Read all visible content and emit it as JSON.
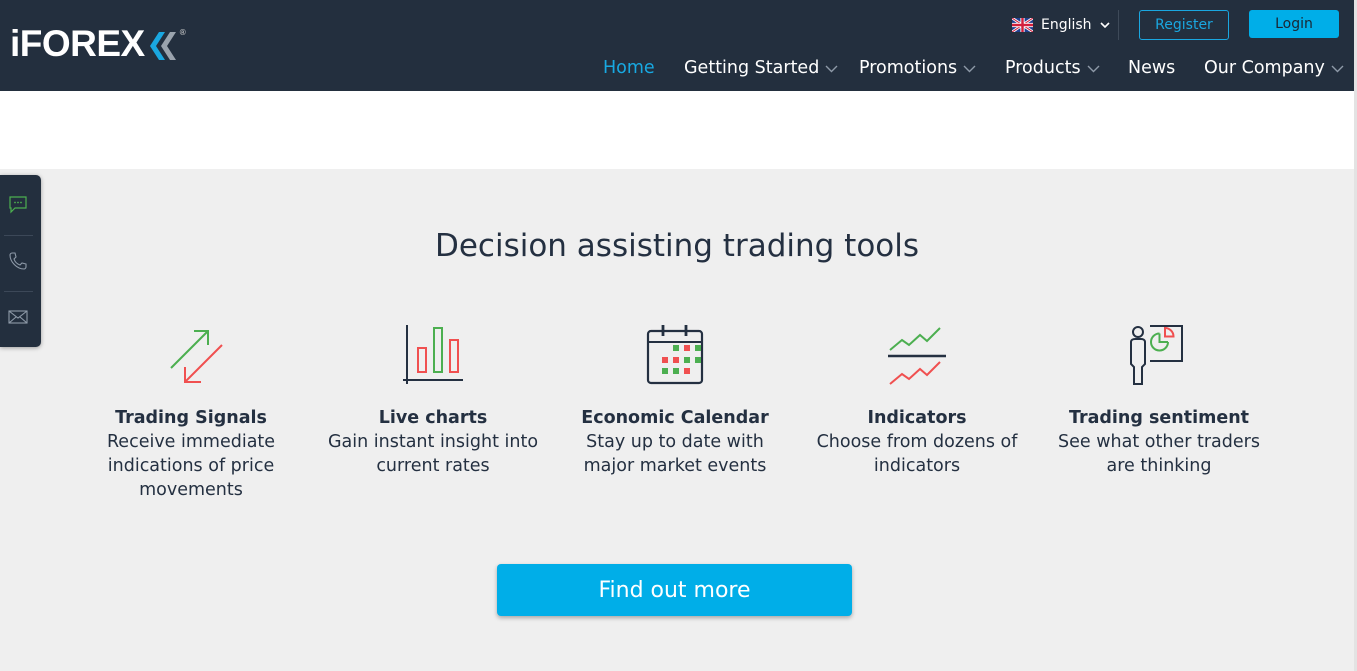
{
  "header": {
    "logo": {
      "text": "iFOREX",
      "registered_mark": "®"
    },
    "language": {
      "flag_icon": "uk-flag-icon",
      "label": "English"
    },
    "register_label": "Register",
    "login_label": "Login",
    "nav": [
      {
        "label": "Home",
        "active": true,
        "has_dropdown": false
      },
      {
        "label": "Getting Started",
        "active": false,
        "has_dropdown": true
      },
      {
        "label": "Promotions",
        "active": false,
        "has_dropdown": true
      },
      {
        "label": "Products",
        "active": false,
        "has_dropdown": true
      },
      {
        "label": "News",
        "active": false,
        "has_dropdown": false
      },
      {
        "label": "Our Company",
        "active": false,
        "has_dropdown": true
      }
    ]
  },
  "side_contact": [
    {
      "icon": "chat-icon"
    },
    {
      "icon": "phone-icon"
    },
    {
      "icon": "mail-icon"
    }
  ],
  "main": {
    "title": "Decision assisting trading tools",
    "tools": [
      {
        "icon": "trading-signals-icon",
        "title": "Trading Signals",
        "desc_lines": [
          "Receive immediate",
          "indications of price",
          "movements"
        ]
      },
      {
        "icon": "live-charts-icon",
        "title": "Live charts",
        "desc_lines": [
          "Gain instant insight into",
          "current rates"
        ]
      },
      {
        "icon": "economic-calendar-icon",
        "title": "Economic Calendar",
        "desc_lines": [
          "Stay up to date with",
          "major market events"
        ]
      },
      {
        "icon": "indicators-icon",
        "title": "Indicators",
        "desc_lines": [
          "Choose from dozens of",
          "indicators"
        ]
      },
      {
        "icon": "trading-sentiment-icon",
        "title": "Trading sentiment",
        "desc_lines": [
          "See what other traders",
          "are thinking"
        ]
      }
    ],
    "cta_label": "Find out more"
  },
  "colors": {
    "header_bg": "#232f3e",
    "accent": "#00aee8",
    "nav_active": "#18a9e2",
    "up_green": "#4caf50",
    "down_red": "#f05050",
    "page_bg": "#efefef"
  }
}
